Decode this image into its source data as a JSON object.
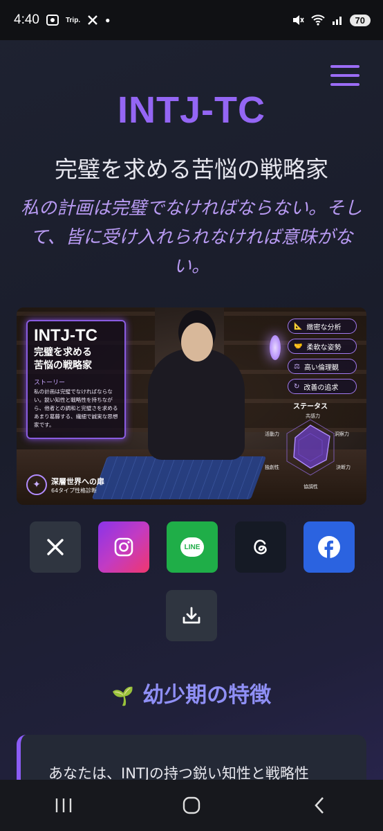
{
  "status_bar": {
    "time": "4:40",
    "trip_label": "Trip.",
    "battery": "70"
  },
  "header": {
    "title": "INTJ-TC",
    "subtitle": "完璧を求める苦悩の戦略家",
    "quote": "私の計画は完璧でなければならない。そして、皆に受け入れられなければ意味がない。"
  },
  "hero_image": {
    "card_title": "INTJ-TC",
    "card_subtitle_line1": "完璧を求める",
    "card_subtitle_line2": "苦悩の戦略家",
    "story_label": "ストーリー",
    "story_text": "私の計画は完璧でなければならない。鋭い知性と戦略性を持ちながら、他者との調和と完璧さを求めるあまり葛藤する、繊細で誠実な思想家です。",
    "tags": [
      {
        "icon": "ruler-icon",
        "label": "緻密な分析"
      },
      {
        "icon": "handshake-icon",
        "label": "柔軟な姿勢"
      },
      {
        "icon": "scales-icon",
        "label": "高い倫理観"
      },
      {
        "icon": "refresh-icon",
        "label": "改善の追求"
      }
    ],
    "status_title": "ステータス",
    "radar_labels": [
      "共感力",
      "洞察力",
      "決断力",
      "協調性",
      "独創性",
      "活動力"
    ],
    "brand_title": "深層世界への扉",
    "brand_sub": "64タイプ性格診断"
  },
  "share_buttons": [
    {
      "name": "x",
      "icon": "x-logo-icon"
    },
    {
      "name": "instagram",
      "icon": "instagram-icon"
    },
    {
      "name": "line",
      "icon": "line-icon",
      "label": "LINE"
    },
    {
      "name": "threads",
      "icon": "threads-icon"
    },
    {
      "name": "facebook",
      "icon": "facebook-icon"
    }
  ],
  "section": {
    "heading": "幼少期の特徴",
    "text": "あなたは、INTJの持つ鋭い知性と戦略性"
  },
  "colors": {
    "accent": "#9466f4",
    "quote": "#b89af2",
    "instagram": "#c23bc3",
    "line": "#1fae48",
    "facebook": "#2b63e0"
  }
}
